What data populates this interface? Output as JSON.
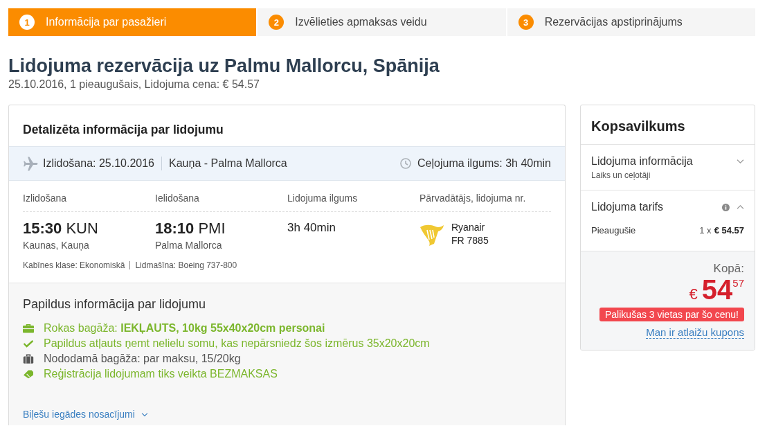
{
  "steps": [
    {
      "number": "1",
      "label": "Informācija par pasažieri",
      "selected": true
    },
    {
      "number": "2",
      "label": "Izvēlieties apmaksas veidu",
      "selected": false
    },
    {
      "number": "3",
      "label": "Rezervācijas apstiprinājums",
      "selected": false
    }
  ],
  "booking_header": {
    "title": "Lidojuma rezervācija uz Palmu Mallorcu, Spānija",
    "subtitle": "25.10.2016, 1 pieaugušais, Lidojuma cena: € 54.57"
  },
  "flight_details": {
    "title": "Detalizēta informācija par lidojumu",
    "route_bar": {
      "departure_date": "Izlidošana: 25.10.2016",
      "route": "Kauņa - Palma Mallorca",
      "travel_time": "Ceļojuma ilgums: 3h 40min"
    },
    "columns": [
      "Izlidošana",
      "Ielidošana",
      "Lidojuma ilgums",
      "Pārvadātājs, lidojuma nr."
    ],
    "departure": {
      "time": "15:30",
      "airport": "KUN",
      "city": "Kaunas, Kauņa"
    },
    "arrival": {
      "time": "18:10",
      "airport": "PMI",
      "city": "Palma Mallorca"
    },
    "duration": "3h 40min",
    "carrier": {
      "name": "Ryanair",
      "flight_number": "FR 7885"
    },
    "cabin_class": "Kabīnes klase: Ekonomiskā",
    "aircraft": "Lidmašīna: Boeing 737-800"
  },
  "additional_info": {
    "title": "Papildus informācija par lidojumu",
    "items": [
      {
        "kind": "briefcase",
        "included": true,
        "text": "Rokas bagāža: **IEKĻAUTS, 10kg 55x40x20cm personai**"
      },
      {
        "kind": "check",
        "included": true,
        "text": "Papildus atļauts ņemt nelielu somu, kas nepārsniedz šos izmērus 35x20x20cm"
      },
      {
        "kind": "suitcase",
        "included": false,
        "text": "Nododamā bagāža: par maksu, 15/20kg"
      },
      {
        "kind": "tag",
        "included": true,
        "text": "Reģistrācija lidojumam tiks veikta BEZMAKSAS"
      }
    ],
    "terms_link": {
      "label": "Biļešu iegādes nosacījumi",
      "expanded": false
    }
  },
  "summary": {
    "title": "Kopsavilkums",
    "sections": [
      {
        "title": "Lidojuma informācija",
        "subtitle": "Laiks un ceļotāji",
        "expanded": false
      },
      {
        "title": "Lidojuma tarifs",
        "info_icon": true,
        "expanded": true,
        "rows": [
          {
            "label": "Pieaugušie",
            "quantity": "1 x",
            "price": "€ 54.57"
          }
        ]
      }
    ],
    "total": {
      "label": "Kopā:",
      "currency": "€",
      "amount": "54$^{57}$",
      "alert": "Palikušas 3 vietas par šo cenu!",
      "coupon_link": "Man ir atlaižu kupons"
    }
  }
}
